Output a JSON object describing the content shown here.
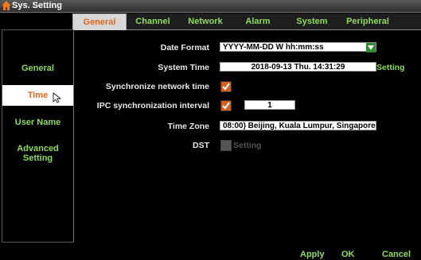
{
  "window": {
    "title": "Sys. Setting"
  },
  "tabs": [
    {
      "label": "General"
    },
    {
      "label": "Channel"
    },
    {
      "label": "Network"
    },
    {
      "label": "Alarm"
    },
    {
      "label": "System"
    },
    {
      "label": "Peripheral"
    }
  ],
  "sidebar": {
    "items": [
      {
        "label": "General"
      },
      {
        "label": "Time"
      },
      {
        "label": "User Name"
      },
      {
        "label": "Advanced Setting"
      }
    ]
  },
  "form": {
    "date_format_label": "Date Format",
    "date_format_value": "YYYY-MM-DD W hh:mm:ss",
    "system_time_label": "System Time",
    "system_time_value": "2018-09-13 Thu. 14:31:29",
    "system_time_setting": "Setting",
    "sync_network_label": "Synchronize network time",
    "sync_network_checked": true,
    "ipc_sync_label": "IPC synchronization interval",
    "ipc_sync_checked": true,
    "ipc_sync_value": "1",
    "timezone_label": "Time Zone",
    "timezone_value": "08:00) Beijing, Kuala Lumpur, Singapore",
    "dst_label": "DST",
    "dst_checked": false,
    "dst_setting": "Setting"
  },
  "footer": {
    "apply": "Apply",
    "ok": "OK",
    "cancel": "Cancel"
  },
  "colors": {
    "accent_green": "#8ddc5a",
    "active_orange": "#e0661c",
    "checkbox_orange": "#d85e1a"
  }
}
